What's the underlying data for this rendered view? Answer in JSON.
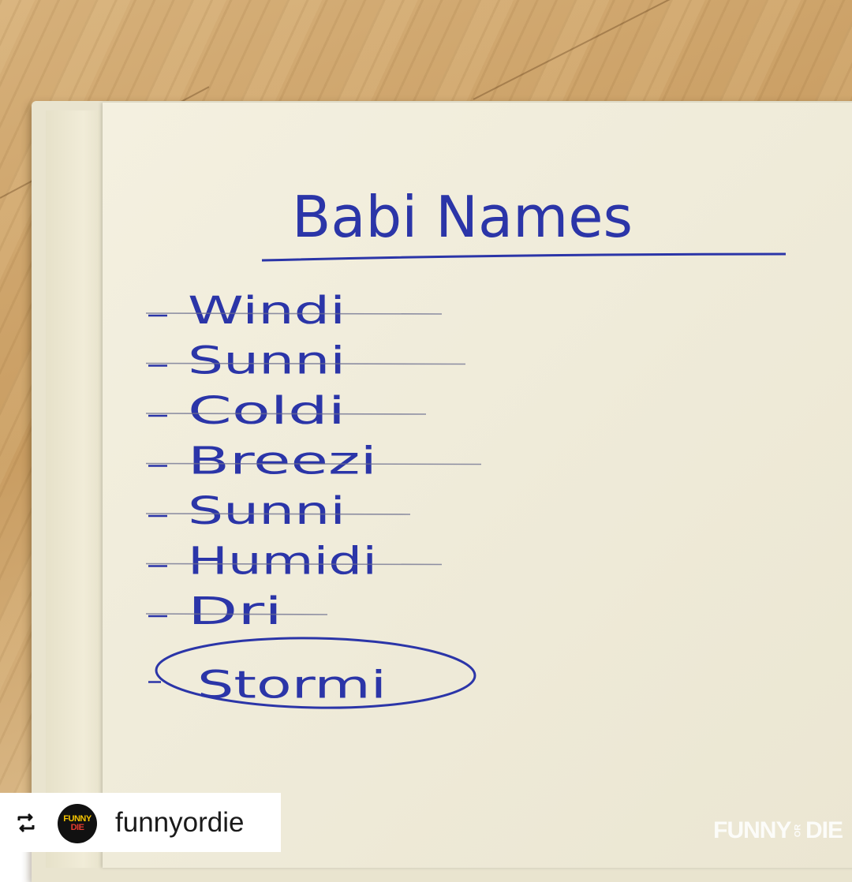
{
  "note": {
    "title": "Babi Names",
    "names": [
      {
        "text": "Windi",
        "crossed_out": true
      },
      {
        "text": "Sunni",
        "crossed_out": true
      },
      {
        "text": "Coldi",
        "crossed_out": true
      },
      {
        "text": "Breezi",
        "crossed_out": true
      },
      {
        "text": "Sunni",
        "crossed_out": true
      },
      {
        "text": "Humidi",
        "crossed_out": true
      },
      {
        "text": "Dri",
        "crossed_out": true
      },
      {
        "text": "Stormi",
        "crossed_out": false,
        "circled": true
      }
    ],
    "ink_color": "#2b35a8"
  },
  "repost": {
    "icon": "repost-icon",
    "avatar_line1": "FUNNY",
    "avatar_line2": "DIE",
    "username": "funnyordie"
  },
  "watermark": {
    "part1": "FUNNY",
    "part2": "OR",
    "part3": "DIE"
  }
}
